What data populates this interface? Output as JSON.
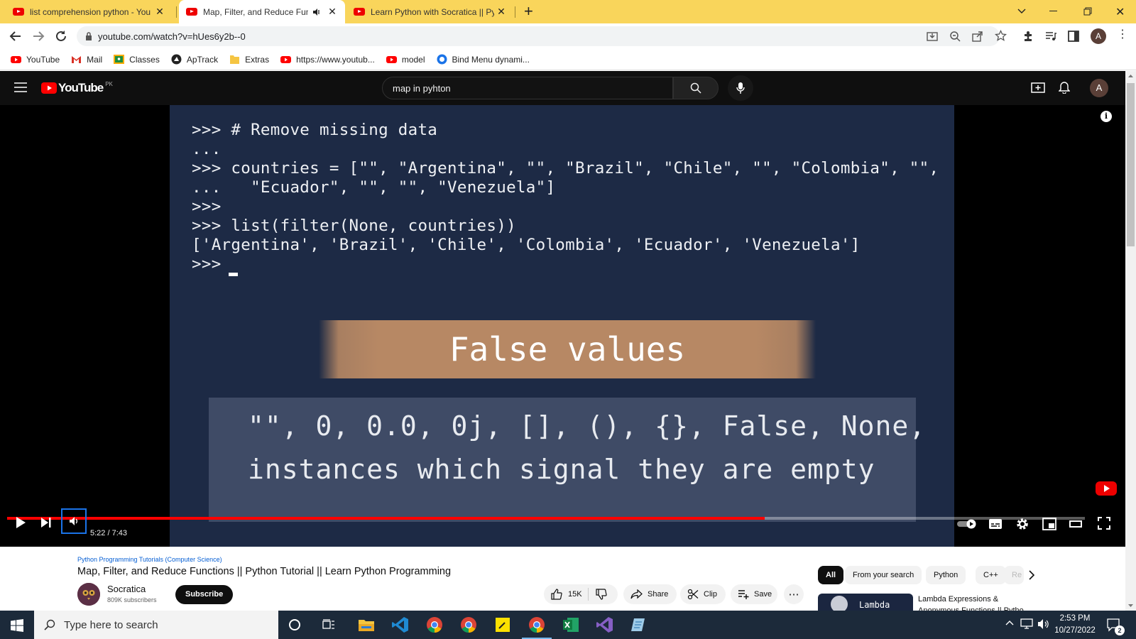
{
  "browser": {
    "tabs": [
      {
        "title": "list comprehension python - You",
        "active": false
      },
      {
        "title": "Map, Filter, and Reduce Func",
        "active": true,
        "audio": true
      },
      {
        "title": "Learn Python with Socratica || Py",
        "active": false
      }
    ],
    "url": "youtube.com/watch?v=hUes6y2b--0",
    "bookmarks": [
      {
        "label": "YouTube",
        "icon": "youtube-icon"
      },
      {
        "label": "Mail",
        "icon": "gmail-icon"
      },
      {
        "label": "Classes",
        "icon": "classroom-icon"
      },
      {
        "label": "ApTrack",
        "icon": "aptrack-icon"
      },
      {
        "label": "Extras",
        "icon": "folder-icon"
      },
      {
        "label": "https://www.youtub...",
        "icon": "youtube-icon"
      },
      {
        "label": "model",
        "icon": "youtube-icon"
      },
      {
        "label": "Bind Menu dynami...",
        "icon": "site-icon"
      }
    ],
    "profile_initial": "A"
  },
  "youtube": {
    "logo_text": "YouTube",
    "region": "PK",
    "search_query": "map in pyhton",
    "avatar_initial": "A",
    "video": {
      "code_lines": [
        ">>> # Remove missing data",
        "...",
        ">>> countries = [\"\", \"Argentina\", \"\", \"Brazil\", \"Chile\", \"\", \"Colombia\", \"\",",
        "...   \"Ecuador\", \"\", \"\", \"Venezuela\"]",
        ">>>",
        ">>> list(filter(None, countries))",
        "['Argentina', 'Brazil', 'Chile', 'Colombia', 'Ecuador', 'Venezuela']",
        ">>>"
      ],
      "false_values_title": "False values",
      "false_values_line1": "\"\", 0, 0.0, 0j, [], (), {}, False, None,",
      "false_values_line2": "instances which signal they are empty",
      "progress_fraction": 0.703,
      "time": "5:22 / 7:43"
    },
    "channel_category": "Python Programming Tutorials (Computer Science)",
    "title": "Map, Filter, and Reduce Functions || Python Tutorial || Learn Python Programming",
    "channel": "Socratica",
    "subscribers": "809K subscribers",
    "subscribe_label": "Subscribe",
    "likes": "15K",
    "share_label": "Share",
    "clip_label": "Clip",
    "save_label": "Save",
    "chips": [
      "All",
      "From your search",
      "Python",
      "C++",
      "Re"
    ],
    "rec_thumb_text": "Lambda",
    "rec_title": "Lambda Expressions &",
    "rec_title2": "Anonymous Functions || Pytho"
  },
  "taskbar": {
    "search_placeholder": "Type here to search",
    "time": "2:53 PM",
    "date": "10/27/2022",
    "notifications": "2"
  },
  "colors": {
    "tab_strip": "#f9d55b",
    "yt_red": "#ff0000",
    "slide_bg": "#1d2a45",
    "false_values_band": "#b78864",
    "taskbar": "#1c2a3a"
  }
}
